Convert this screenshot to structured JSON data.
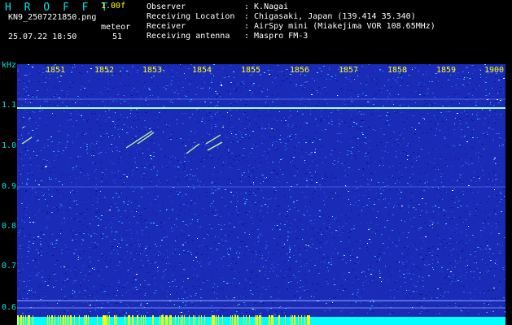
{
  "header": {
    "title": "H R O F F T",
    "version": "1.00f",
    "filename": "KN9_2507221850.png",
    "datetime": "25.07.22 18:50",
    "meteor_label": "meteor",
    "meteor_count": "51"
  },
  "info": [
    {
      "label": "Observer",
      "value": ": K.Nagai"
    },
    {
      "label": "Receiving Location",
      "value": ": Chigasaki, Japan (139.414 35.340)"
    },
    {
      "label": "Receiver",
      "value": ": AirSpy mini (Miakejima VOR 108.65MHz)"
    },
    {
      "label": "Receiving antenna",
      "value": ": Maspro FM-3"
    }
  ],
  "axes": {
    "y_unit": "kHz",
    "y_ticks": [
      "1.1",
      "1.0",
      "0.9",
      "0.8",
      "0.7",
      "0.6"
    ],
    "x_ticks": [
      "1851",
      "1852",
      "1853",
      "1854",
      "1855",
      "1856",
      "1857",
      "1858",
      "1859",
      "1900"
    ]
  },
  "colors": {
    "background": "#000000",
    "spectrogram": "#1a2bb8",
    "carrier_line": "#a8ffe0",
    "yellow_text": "#ffff00",
    "cyan_text": "#00e5e5",
    "bottom_band": "#00ffff"
  }
}
